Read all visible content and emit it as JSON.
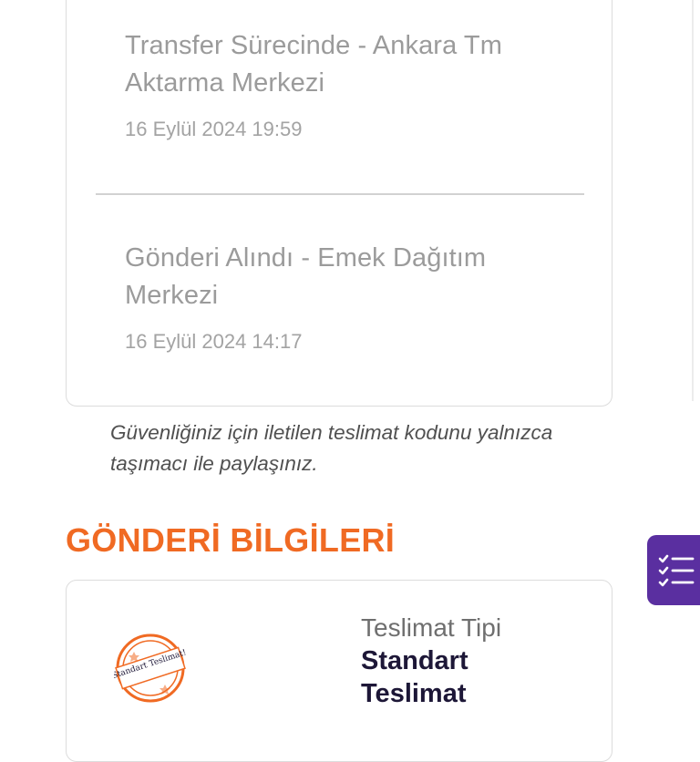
{
  "tracking": {
    "events": [
      {
        "title": "Transfer Sürecinde - Ankara Tm Aktarma Merkezi",
        "date": "16 Eylül 2024 19:59"
      },
      {
        "title": "Gönderi Alındı - Emek Dağıtım Merkezi",
        "date": "16 Eylül 2024 14:17"
      }
    ]
  },
  "notice": "Güvenliğiniz için iletilen teslimat kodunu yalnızca taşımacı ile paylaşınız.",
  "shipment_info": {
    "section_title": "GÖNDERİ BİLGİLERİ",
    "delivery_type_label": "Teslimat Tipi",
    "delivery_type_value": "Standart Teslimat",
    "stamp_text": "Standart Teslimat!"
  },
  "colors": {
    "accent": "#f06a23",
    "fab": "#5a2fa0",
    "value_text": "#1d1737"
  },
  "icons": {
    "fab": "checklist-icon",
    "stamp": "standard-delivery-stamp-icon"
  }
}
